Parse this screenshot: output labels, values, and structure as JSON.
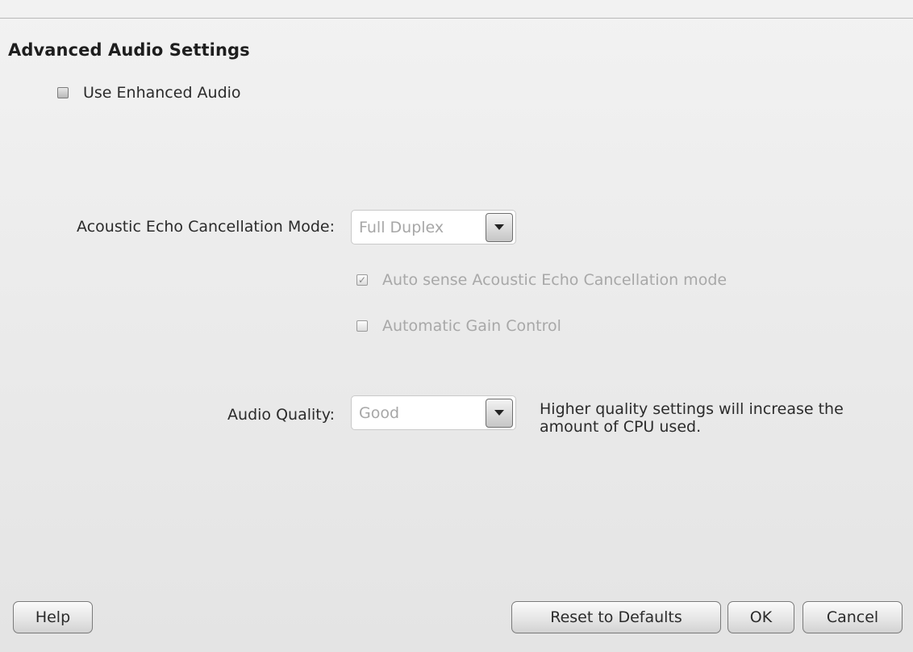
{
  "dialog": {
    "title": "Advanced Audio Settings"
  },
  "enhanced_audio": {
    "label": "Use Enhanced Audio",
    "checked": false
  },
  "echo_cancellation": {
    "label": "Acoustic Echo Cancellation Mode:",
    "selected": "Full Duplex",
    "auto_sense": {
      "label": "Auto sense Acoustic Echo Cancellation mode",
      "checked": true,
      "enabled": false
    },
    "gain_control": {
      "label": "Automatic Gain Control",
      "checked": false,
      "enabled": false
    }
  },
  "audio_quality": {
    "label": "Audio Quality:",
    "selected": "Good",
    "hint": "Higher quality settings will increase the amount of CPU used."
  },
  "buttons": {
    "help": "Help",
    "reset": "Reset to Defaults",
    "ok": "OK",
    "cancel": "Cancel"
  },
  "icons": {
    "dropdown": "chevron-down-icon",
    "checkmark": "check-icon"
  },
  "colors": {
    "background": "#ececec",
    "text": "#2b2b2b",
    "disabled_text": "#a8a8a8"
  }
}
